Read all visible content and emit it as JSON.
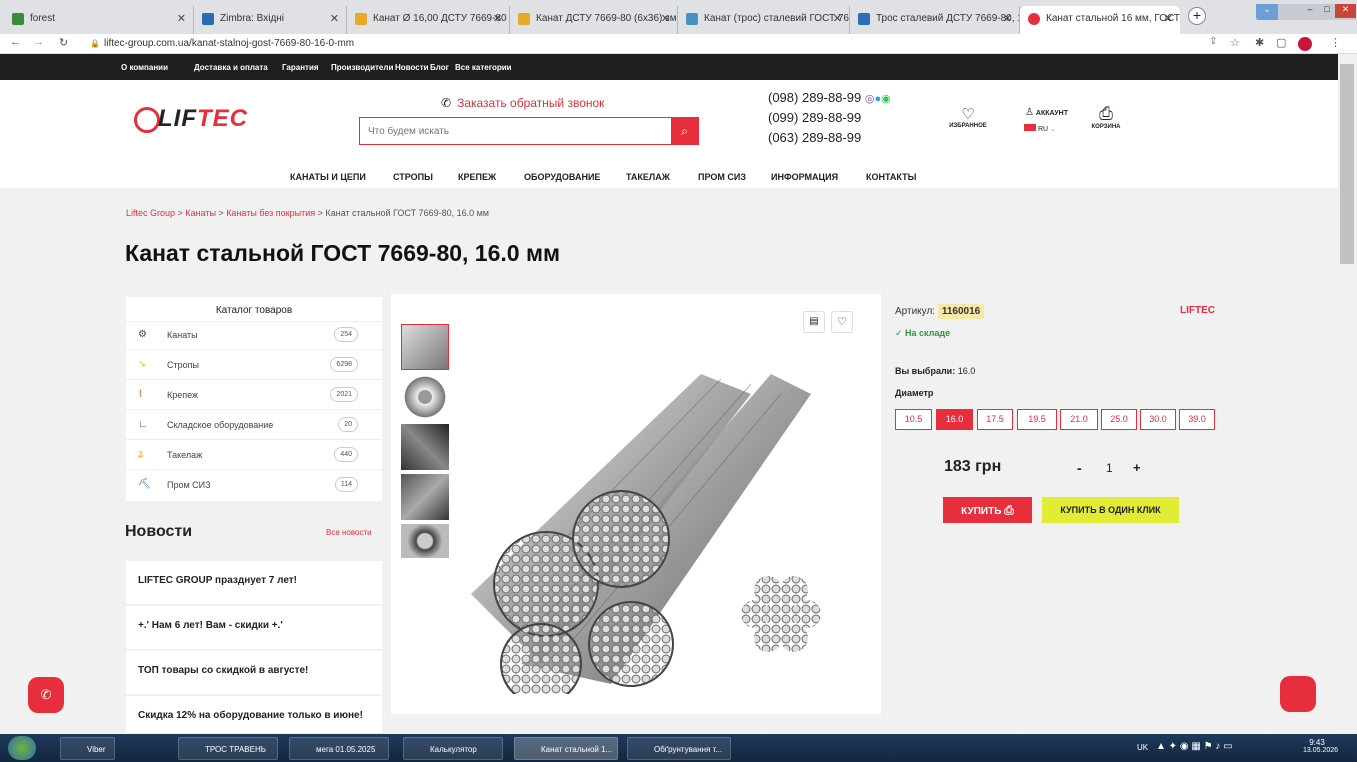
{
  "browser": {
    "tabs": [
      {
        "label": "forest"
      },
      {
        "label": "Zimbra: Вхідні"
      },
      {
        "label": "Канат Ø 16,00 ДСТУ 7669-80 - П..."
      },
      {
        "label": "Канат ДСТУ 7669-80 (6х36) змащ..."
      },
      {
        "label": "Канат (трос) сталевий ГОСТ 766..."
      },
      {
        "label": "Трос сталевий ДСТУ 7669-80, 16..."
      },
      {
        "label": "Канат стальной 16 мм, ГОСТ 76..."
      }
    ],
    "url": "liftec-group.com.ua/kanat-stalnoj-gost-7669-80-16-0-mm"
  },
  "topnav": [
    "О компании",
    "Доставка и оплата",
    "Гарантия",
    "Производители",
    "Новости",
    "Блог",
    "Все категории"
  ],
  "header": {
    "logo_prefix": "LIF",
    "logo_accent": "TEC",
    "callback": "Заказать обратный звонок",
    "search_placeholder": "Что будем искать",
    "phones": [
      "(098) 289-88-99",
      "(099) 289-88-99",
      "(063) 289-88-99"
    ],
    "favorites": "ИЗБРАННОЕ",
    "account": "АККАУНТ",
    "lang": "RU",
    "cart": "КОРЗИНА"
  },
  "mainnav": [
    "КАНАТЫ И ЦЕПИ",
    "СТРОПЫ",
    "КРЕПЕЖ",
    "ОБОРУДОВАНИЕ",
    "ТАКЕЛАЖ",
    "ПРОМ СИЗ",
    "ИНФОРМАЦИЯ",
    "КОНТАКТЫ"
  ],
  "breadcrumbs": [
    "Liftec Group",
    "Канаты",
    "Канаты без покрытия",
    "Канат стальной ГОСТ 7669-80, 16.0 мм"
  ],
  "page_title": "Канат стальной ГОСТ 7669-80, 16.0 мм",
  "catalog": {
    "title": "Каталог товаров",
    "items": [
      {
        "label": "Канаты",
        "count": "254"
      },
      {
        "label": "Стропы",
        "count": "6298"
      },
      {
        "label": "Крепеж",
        "count": "2021"
      },
      {
        "label": "Складское оборудование",
        "count": "20"
      },
      {
        "label": "Такелаж",
        "count": "440"
      },
      {
        "label": "Пром СИЗ",
        "count": "114"
      }
    ]
  },
  "news": {
    "title": "Новости",
    "all": "Все новости",
    "items": [
      "LIFTEC GROUP празднует 7 лет!",
      "+.' Нам 6 лет! Вам - скидки +.'",
      "ТОП товары со скидкой в августе!",
      "Скидка 12% на оборудование только в июне!"
    ]
  },
  "product": {
    "article_label": "Артикул:",
    "article": "1160016",
    "brand": "LIFTEC",
    "stock": "✓ На складе",
    "selected_label": "Вы выбрали:",
    "selected_value": "16.0",
    "diameter_label": "Диаметр",
    "diameters": [
      "10.5",
      "16.0",
      "17.5",
      "19.5",
      "21.0",
      "25.0",
      "30.0",
      "39.0"
    ],
    "price": "183 грн",
    "qty": "1",
    "buy": "КУПИТЬ",
    "one_click": "КУПИТЬ В ОДИН КЛИК"
  },
  "taskbar": [
    "Viber",
    "ТРОС ТРАВЕНЬ",
    "мега 01.05.2025",
    "Калькулятор",
    "Канат стальной 1...",
    "Обґрунтування т..."
  ],
  "tray": {
    "lang": "UK",
    "time": "9:43",
    "date": "13.05.2026"
  }
}
